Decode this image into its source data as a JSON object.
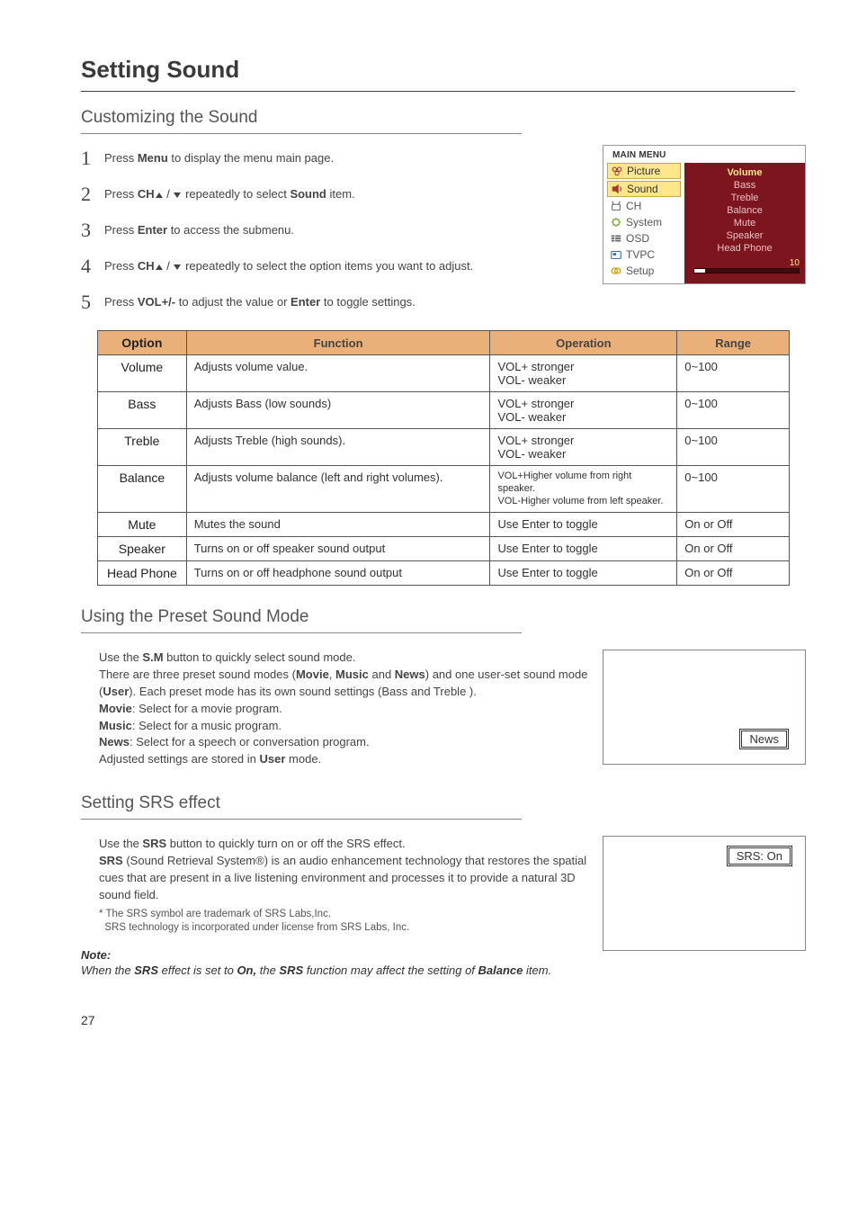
{
  "pageTitle": "Setting Sound",
  "pageNumber": "27",
  "customize": {
    "heading": "Customizing the Sound",
    "steps": [
      {
        "num": "1",
        "pre": "Press  ",
        "bold1": "Menu",
        "post": " to display the menu main page."
      },
      {
        "num": "2",
        "pre": "Press ",
        "bold1": "CH",
        "arrows": true,
        "mid": " repeatedly to select ",
        "bold2": "Sound",
        "post": " item."
      },
      {
        "num": "3",
        "pre": "Press ",
        "bold1": "Enter",
        "post": " to access the submenu."
      },
      {
        "num": "4",
        "pre": "Press  ",
        "bold1": "CH",
        "arrows": true,
        "post": " repeatedly to select the option items you want to adjust."
      },
      {
        "num": "5",
        "pre": "Press  ",
        "bold1": "VOL",
        "plusminus": "+/-",
        "mid": " to adjust the value  or ",
        "bold2": "Enter",
        "post": " to toggle settings."
      }
    ]
  },
  "osd": {
    "title": "MAIN MENU",
    "left": [
      "Picture",
      "Sound",
      "CH",
      "System",
      "OSD",
      "TVPC",
      "Setup"
    ],
    "right": {
      "active": "Volume",
      "items": [
        "Bass",
        "Treble",
        "Balance",
        "Mute",
        "Speaker",
        "Head Phone"
      ],
      "value": "10"
    }
  },
  "table": {
    "headers": [
      "Option",
      "Function",
      "Operation",
      "Range"
    ],
    "rows": [
      {
        "opt": "Volume",
        "fn": "Adjusts volume value.",
        "op": "VOL+  stronger\nVOL-  weaker",
        "rg": "0~100"
      },
      {
        "opt": "Bass",
        "fn": "Adjusts Bass (low sounds)",
        "op": "VOL+  stronger\nVOL-  weaker",
        "rg": "0~100"
      },
      {
        "opt": "Treble",
        "fn": "Adjusts Treble (high sounds).",
        "op": "VOL+  stronger\nVOL-  weaker",
        "rg": "0~100"
      },
      {
        "opt": "Balance",
        "fn": "Adjusts volume balance (left and right volumes).",
        "op_small": "VOL+Higher volume from right speaker.\nVOL-Higher volume from left speaker.",
        "rg": "0~100"
      },
      {
        "opt": "Mute",
        "fn": "Mutes the sound",
        "op": "Use Enter to toggle",
        "rg": "On or Off"
      },
      {
        "opt": "Speaker",
        "fn": "Turns on or off speaker sound output",
        "op": "Use Enter to toggle",
        "rg": "On or Off"
      },
      {
        "opt": "Head Phone",
        "fn": "Turns on or off headphone sound output",
        "op": "Use Enter to toggle",
        "rg": "On or Off"
      }
    ]
  },
  "preset": {
    "heading": "Using the Preset Sound Mode",
    "intro1a": "Use the ",
    "intro1b": "S.M",
    "intro1c": " button to quickly select sound mode.",
    "intro2a": "There are three preset sound modes (",
    "intro2b": "Movie",
    "intro2c": ", ",
    "intro2d": "Music",
    "intro2e": " and ",
    "intro2f": "News",
    "intro2g": ") and one user-set sound mode (",
    "intro2h": "User",
    "intro2i": "). Each preset mode has its own sound settings (Bass and Treble ).",
    "movie_b": "Movie",
    "movie_t": ": Select for a movie program.",
    "music_b": "Music",
    "music_t": ": Select for a music program.",
    "news_b": "News",
    "news_t": ": Select for a speech or conversation program.",
    "adj_a": "Adjusted settings are stored in ",
    "adj_b": "User",
    "adj_c": " mode.",
    "sideLabel": "News"
  },
  "srs": {
    "heading": "Setting SRS effect",
    "line1a": "Use the ",
    "line1b": "SRS",
    "line1c": " button to quickly turn on or off the SRS effect.",
    "line2a": "SRS",
    "line2b": " (Sound Retrieval System®) is an audio enhancement technology that restores the spatial cues that are present in a live listening environment and processes it to provide a natural 3D sound field.",
    "foot1": "* The SRS symbol are trademark of SRS Labs,Inc.",
    "foot2": "SRS technology is incorporated under license from SRS Labs, Inc.",
    "noteLabel": "Note:",
    "noteText_a": "When the ",
    "noteText_b": "SRS",
    "noteText_c": " effect is set to ",
    "noteText_d": "On,",
    "noteText_e": " the ",
    "noteText_f": "SRS",
    "noteText_g": " function may affect the setting of ",
    "noteText_h": "Balance",
    "noteText_i": " item.",
    "sideLabel": "SRS:  On"
  }
}
